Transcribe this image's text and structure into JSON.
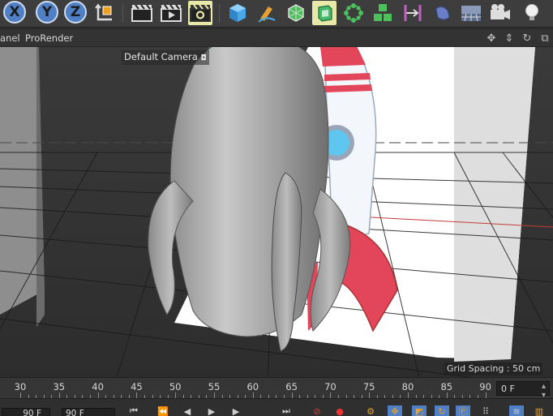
{
  "toolbar": {
    "axis_x": "X",
    "axis_y": "Y",
    "axis_z": "Z",
    "icons": [
      "coordinate-system-icon",
      "render-view-icon",
      "render-picture-viewer-icon",
      "render-settings-icon",
      "cube-icon",
      "pen-icon",
      "subdivision-icon",
      "extrude-icon",
      "array-icon",
      "mograph-icon",
      "symmetry-icon",
      "deformer-icon",
      "floor-icon",
      "camera-icon",
      "light-icon"
    ]
  },
  "menubar": {
    "panel": "anel",
    "prorender": "ProRender",
    "nav_icons": [
      "move-view-icon",
      "zoom-view-icon",
      "rotate-view-icon",
      "maximize-view-icon"
    ]
  },
  "viewport": {
    "camera_label": "Default Camera",
    "grid_spacing": "Grid Spacing : 50 cm"
  },
  "timeline": {
    "ticks": [
      "30",
      "35",
      "40",
      "45",
      "50",
      "55",
      "60",
      "65",
      "70",
      "75",
      "80",
      "85",
      "90"
    ],
    "current_frame": "0 F"
  },
  "transport": {
    "start_frame": "90 F",
    "end_frame": "90 F"
  },
  "colors": {
    "accent_blue": "#4f7fc4",
    "rocket_red": "#e3455a",
    "grid_red_axis": "#c23b3b",
    "grid_green_axis": "#3cb05a"
  }
}
